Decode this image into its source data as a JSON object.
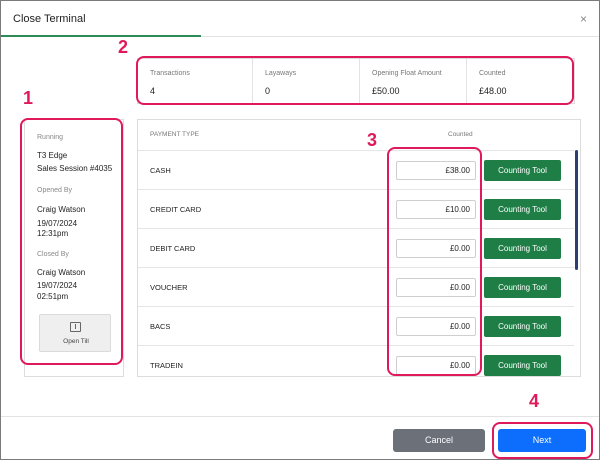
{
  "window": {
    "title": "Close Terminal",
    "close_glyph": "×"
  },
  "annotations": [
    "1",
    "2",
    "3",
    "4"
  ],
  "session": {
    "running_label": "Running",
    "terminal_name": "T3 Edge",
    "session_name": "Sales Session #4035",
    "opened_by_label": "Opened By",
    "opened_by": "Craig Watson",
    "opened_date": "19/07/2024",
    "opened_time": "12:31pm",
    "closed_by_label": "Closed By",
    "closed_by": "Craig Watson",
    "closed_date": "19/07/2024",
    "closed_time": "02:51pm",
    "open_till_label": "Open Till"
  },
  "stats": [
    {
      "label": "Transactions",
      "value": "4"
    },
    {
      "label": "Layaways",
      "value": "0"
    },
    {
      "label": "Opening Float Amount",
      "value": "£50.00"
    },
    {
      "label": "Counted",
      "value": "£48.00"
    }
  ],
  "payments": {
    "header_type": "PAYMENT TYPE",
    "header_counted": "Counted",
    "tool_label": "Counting Tool",
    "rows": [
      {
        "type": "CASH",
        "counted": "£38.00"
      },
      {
        "type": "CREDIT CARD",
        "counted": "£10.00"
      },
      {
        "type": "DEBIT CARD",
        "counted": "£0.00"
      },
      {
        "type": "VOUCHER",
        "counted": "£0.00"
      },
      {
        "type": "BACS",
        "counted": "£0.00"
      },
      {
        "type": "TRADEIN",
        "counted": "£0.00"
      }
    ]
  },
  "footer": {
    "cancel_label": "Cancel",
    "next_label": "Next"
  },
  "colors": {
    "annotation": "#e0195a",
    "tool_button": "#1e7e46",
    "next_button": "#0d6efd",
    "cancel_button": "#6b7079",
    "tab_underline": "#2e8b57"
  }
}
